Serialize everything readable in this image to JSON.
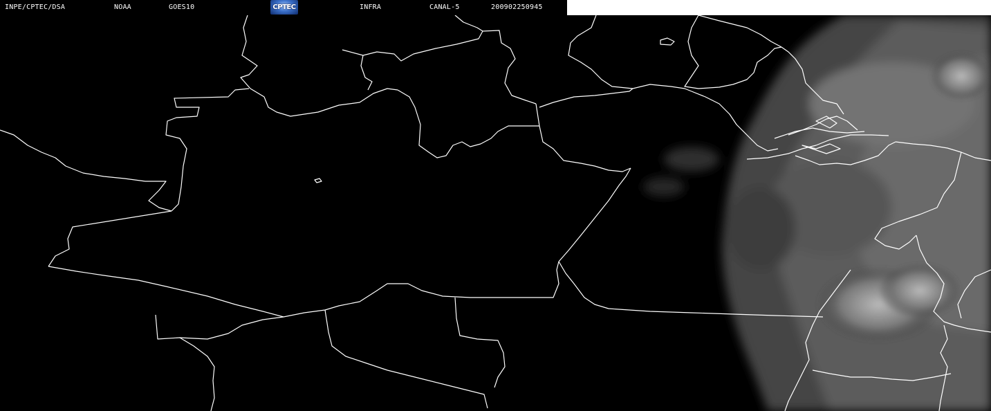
{
  "header": {
    "institution": "INPE/CPTEC/DSA",
    "agency": "NOAA",
    "satellite": "GOES10",
    "logo_text": "CPTEC",
    "product": "INFRA",
    "channel": "CANAL-5",
    "timestamp": "200902250945"
  },
  "map": {
    "type": "satellite-infrared-image",
    "border_color": "#ffffff",
    "cloud_color": "#8a8a8a",
    "background_color": "#000000"
  }
}
